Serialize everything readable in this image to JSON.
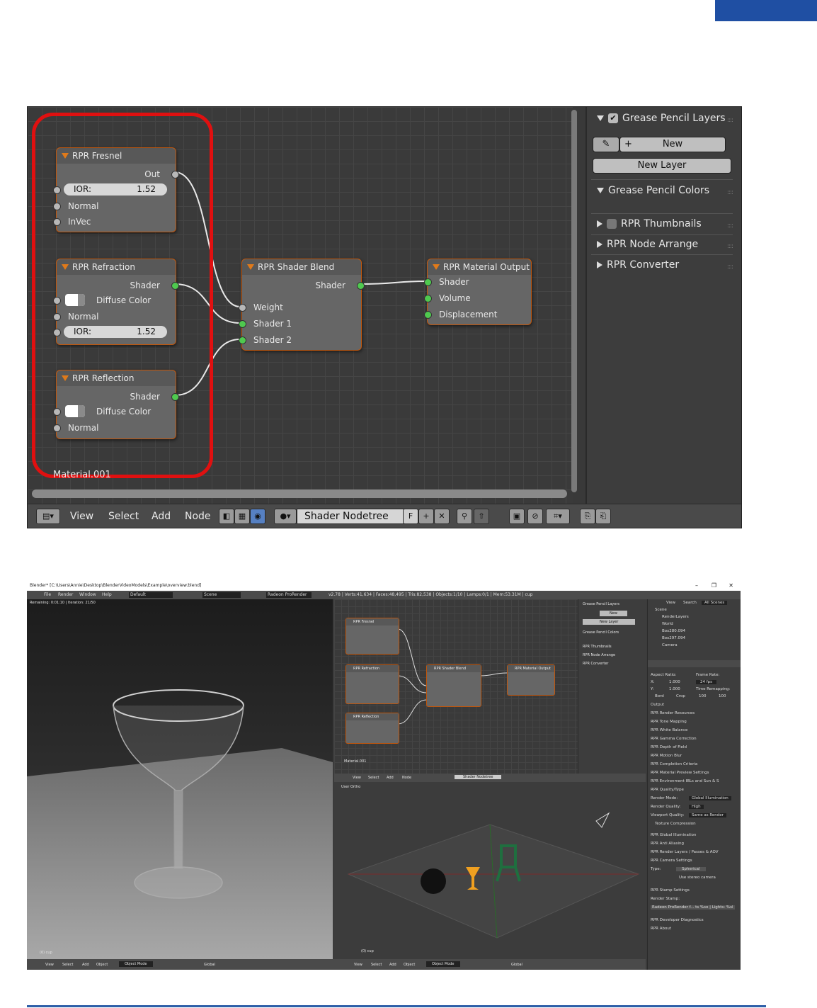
{
  "node_editor": {
    "nodes": {
      "fresnel": {
        "title": "RPR Fresnel",
        "out": "Out",
        "ior_label": "IOR:",
        "ior_value": "1.52",
        "normal": "Normal",
        "invec": "InVec"
      },
      "refraction": {
        "title": "RPR Refraction",
        "out": "Shader",
        "diffuse": "Diffuse Color",
        "normal": "Normal",
        "ior_label": "IOR:",
        "ior_value": "1.52"
      },
      "reflection": {
        "title": "RPR Reflection",
        "out": "Shader",
        "diffuse": "Diffuse Color",
        "normal": "Normal"
      },
      "blend": {
        "title": "RPR Shader Blend",
        "out": "Shader",
        "weight": "Weight",
        "shader1": "Shader 1",
        "shader2": "Shader 2"
      },
      "output": {
        "title": "RPR Material Output",
        "shader": "Shader",
        "volume": "Volume",
        "displacement": "Displacement"
      }
    },
    "material_label": "Material.001",
    "side_panel": {
      "grease_layers": "Grease Pencil Layers",
      "new_button": "New",
      "new_layer_button": "New Layer",
      "grease_colors": "Grease Pencil Colors",
      "thumbnails": "RPR Thumbnails",
      "node_arrange": "RPR Node Arrange",
      "converter": "RPR Converter"
    },
    "header": {
      "view": "View",
      "select": "Select",
      "add": "Add",
      "node": "Node",
      "nodetree": "Shader Nodetree",
      "fake_user": "F"
    }
  },
  "blender_window": {
    "title": "Blender* [C:\\Users\\Annie\\Desktop\\BlenderVideoModels\\Example\\overview.blend]",
    "menus": [
      "File",
      "Render",
      "Window",
      "Help"
    ],
    "layout": "Default",
    "scene": "Scene",
    "engine": "Radeon ProRender",
    "stats": "v2.78 | Verts:41,634 | Faces:48,495 | Tris:82,538 | Objects:1/10 | Lamps:0/1 | Mem:53.31M | cup",
    "render_status": "Remaining: 0:01:10 | Iteration: 21/50",
    "viewport_label": "User Ortho",
    "object_label": "(0) cup",
    "bottom_menus": [
      "View",
      "Select",
      "Add",
      "Object"
    ],
    "mode": "Object Mode",
    "orientation": "Global",
    "outliner": {
      "tabs": [
        "View",
        "Search",
        "All Scenes"
      ],
      "items": [
        "Scene",
        "RenderLayers",
        "World",
        "Box280.094",
        "Box297.094",
        "Camera"
      ]
    },
    "properties": {
      "aspect_ratio": "Aspect Ratio:",
      "frame_rate": "Frame Rate:",
      "x_label": "X:",
      "x_val": "1.000",
      "y_label": "Y:",
      "y_val": "1.000",
      "fps": "24 fps",
      "time_remap": "Time Remapping:",
      "remap_a": "100",
      "remap_b": "100",
      "border": "Bord",
      "crop": "Crop",
      "sections": [
        "Output",
        "RPR Render Resources",
        "RPR Tone Mapping",
        "RPR White Balance",
        "RPR Gamma Correction",
        "RPR Depth of Field",
        "RPR Motion Blur",
        "RPR Completion Criteria",
        "RPR Material Preview Settings",
        "RPR Environment IBLs and Sun & S"
      ],
      "quality_type": "RPR Quality/Type",
      "render_mode_label": "Render Mode:",
      "render_mode": "Global Illumination",
      "render_quality_label": "Render Quality:",
      "render_quality": "High",
      "viewport_quality_label": "Viewport Quality:",
      "viewport_quality": "Same as Render",
      "texture_compression": "Texture Compression",
      "sections2": [
        "RPR Global Illumination",
        "RPR Anti Aliasing",
        "RPR Render Layers / Passes & AOV"
      ],
      "camera_settings": "RPR Camera Settings",
      "type_label": "Type:",
      "type_value": "Spherical",
      "stereo": "Use stereo camera",
      "stamp": "RPR Stamp Settings",
      "render_stamp": "Render Stamp:",
      "stamp_value": "Radeon ProRender f... ts %so | Lights: %sl",
      "dev_diag": "RPR Developer Diagnostics",
      "about": "RPR About"
    }
  }
}
